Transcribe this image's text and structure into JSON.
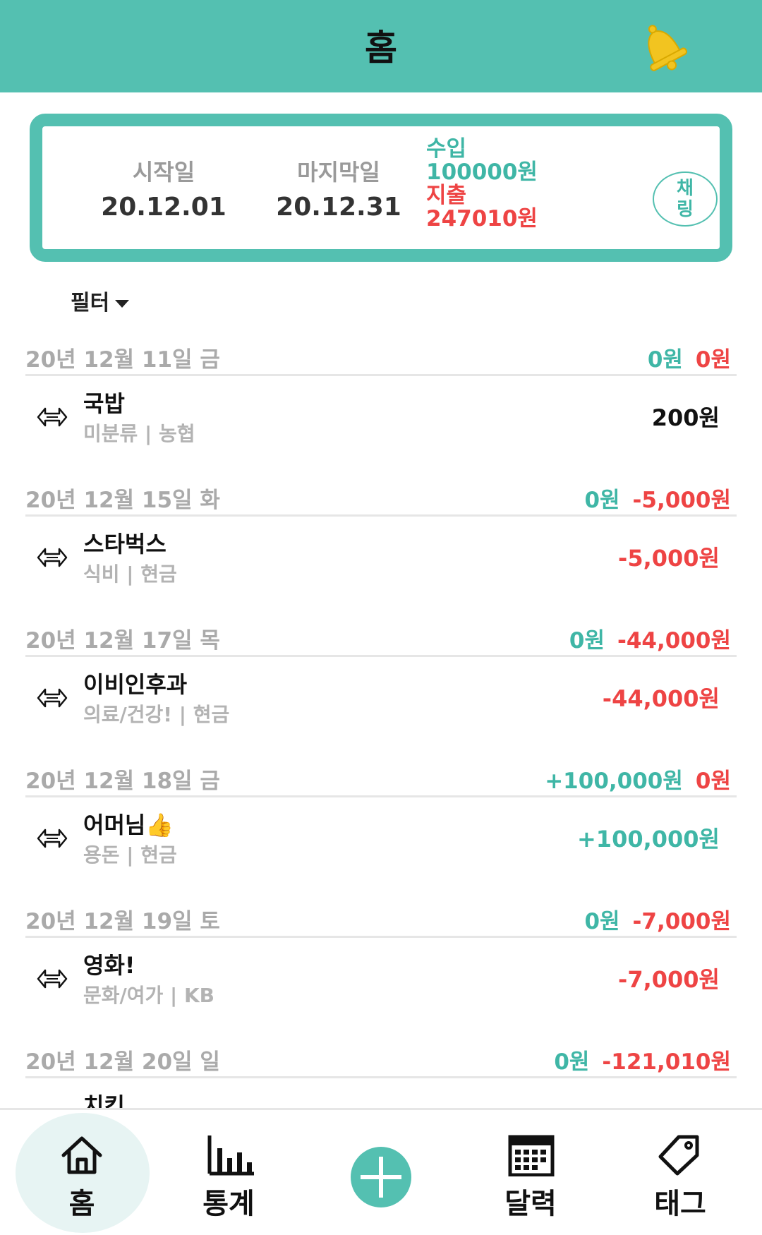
{
  "header": {
    "title": "홈"
  },
  "summary": {
    "start_label": "시작일",
    "start_date": "20.12.01",
    "end_label": "마지막일",
    "end_date": "20.12.31",
    "income_label": "수입",
    "income_value": "100000원",
    "expense_label": "지출",
    "expense_value": "247010원",
    "chaeril_label": "채링"
  },
  "filter": {
    "label": "필터"
  },
  "days": [
    {
      "date": "20년 12월 11일 금",
      "income": "0원",
      "expense": "0원",
      "item": {
        "name": "국밥",
        "sub": "미분류 | 농협",
        "amount": "200원",
        "kind": "neutral"
      }
    },
    {
      "date": "20년 12월 15일 화",
      "income": "0원",
      "expense": "-5,000원",
      "item": {
        "name": "스타벅스",
        "sub": "식비 | 현금",
        "amount": "-5,000원",
        "kind": "exp"
      }
    },
    {
      "date": "20년 12월 17일 목",
      "income": "0원",
      "expense": "-44,000원",
      "item": {
        "name": "이비인후과",
        "sub": "의료/건강! | 현금",
        "amount": "-44,000원",
        "kind": "exp"
      }
    },
    {
      "date": "20년 12월 18일 금",
      "income": "+100,000원",
      "expense": "0원",
      "item": {
        "name": "어머님👍",
        "sub": "용돈 | 현금",
        "amount": "+100,000원",
        "kind": "inc"
      }
    },
    {
      "date": "20년 12월 19일 토",
      "income": "0원",
      "expense": "-7,000원",
      "item": {
        "name": "영화!",
        "sub": "문화/여가 | KB",
        "amount": "-7,000원",
        "kind": "exp"
      }
    },
    {
      "date": "20년 12월 20일 일",
      "income": "0원",
      "expense": "-121,010원",
      "item": {
        "name": "치킨",
        "sub": "",
        "amount": "",
        "kind": "exp"
      }
    }
  ],
  "nav": {
    "home": "홈",
    "stats": "통계",
    "calendar": "달력",
    "tag": "태그"
  },
  "colors": {
    "accent": "#54c0b1",
    "income": "#3fb6a6",
    "expense": "#ee4444",
    "bell": "#f2c420"
  }
}
